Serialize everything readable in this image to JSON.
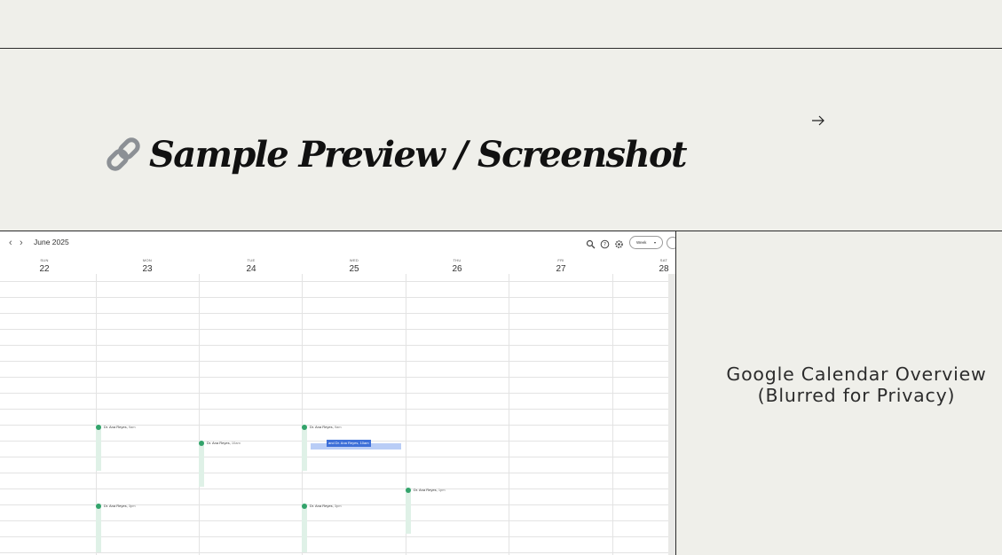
{
  "page": {
    "title": "Sample Preview / Screenshot",
    "caption_line1": "Google Calendar Overview",
    "caption_line2": "(Blurred for Privacy)"
  },
  "icons": {
    "title_icon": "link-icon",
    "next": "arrow-right-icon"
  },
  "calendar": {
    "month_label": "June 2025",
    "prev_label": "‹",
    "next_label": "›",
    "view_label": "Week",
    "view_caret": "▾",
    "days": [
      {
        "dow": "SUN",
        "num": "22"
      },
      {
        "dow": "MON",
        "num": "23"
      },
      {
        "dow": "TUE",
        "num": "24"
      },
      {
        "dow": "WED",
        "num": "25"
      },
      {
        "dow": "THU",
        "num": "26"
      },
      {
        "dow": "FRI",
        "num": "27"
      },
      {
        "dow": "SAT",
        "num": "28"
      }
    ],
    "events": [
      {
        "name": "Dr. Ana Reyes,",
        "time": "9am"
      },
      {
        "name": "Dr. Ana Reyes,",
        "time": "10am"
      },
      {
        "name": "Dr. Ana Reyes,",
        "time": "9am"
      },
      {
        "name": "Dr. Ana Reyes,",
        "time": "1pm"
      },
      {
        "name": "Dr. Ana Reyes,",
        "time": "3pm"
      },
      {
        "name": "Dr. Ana Reyes,",
        "time": "3pm"
      }
    ],
    "dragging_event": "and Dr. Ana Reyes, 10am"
  },
  "colors": {
    "background": "#efefea",
    "event_green": "#33a36b",
    "event_fill": "#dff1e7",
    "drag_blue": "#3d6fd8"
  }
}
